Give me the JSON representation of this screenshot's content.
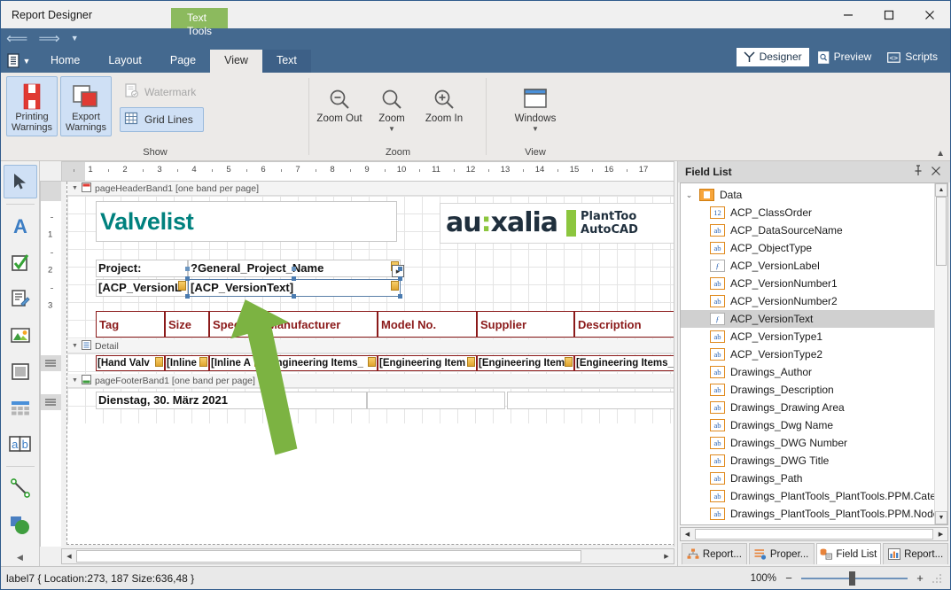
{
  "window": {
    "title": "Report Designer",
    "minimize": "—",
    "maximize": "□",
    "close": "✕"
  },
  "quick_access": {
    "undo_icon": "undo-icon",
    "redo_icon": "redo-icon",
    "customize_icon": "chevron-down-icon",
    "app_menu_icon": "application-menu-icon"
  },
  "ribbon": {
    "contextual_group": "Text Tools",
    "tabs": [
      {
        "label": "Home",
        "active": false
      },
      {
        "label": "Layout",
        "active": false
      },
      {
        "label": "Page",
        "active": false
      },
      {
        "label": "View",
        "active": true
      },
      {
        "label": "Text",
        "active": false,
        "contextual": true
      }
    ],
    "view_modes": [
      {
        "label": "Designer",
        "icon": "designer-icon",
        "active": true
      },
      {
        "label": "Preview",
        "icon": "preview-icon",
        "active": false
      },
      {
        "label": "Scripts",
        "icon": "scripts-icon",
        "active": false
      }
    ],
    "groups": [
      {
        "title": "Show",
        "big_buttons": [
          {
            "label_line1": "Printing",
            "label_line2": "Warnings",
            "icon": "printing-warnings-icon",
            "checked": true
          },
          {
            "label_line1": "Export",
            "label_line2": "Warnings",
            "icon": "export-warnings-icon",
            "checked": true
          }
        ],
        "small_buttons": [
          {
            "label": "Watermark",
            "icon": "watermark-icon",
            "disabled": true,
            "checked": false
          },
          {
            "label": "Grid Lines",
            "icon": "grid-lines-icon",
            "disabled": false,
            "checked": true
          }
        ]
      },
      {
        "title": "Zoom",
        "buttons": [
          {
            "label": "Zoom Out",
            "icon": "zoom-out-icon",
            "dropdown": false
          },
          {
            "label": "Zoom",
            "icon": "zoom-icon",
            "dropdown": true
          },
          {
            "label": "Zoom In",
            "icon": "zoom-in-icon",
            "dropdown": false
          }
        ]
      },
      {
        "title": "View",
        "buttons": [
          {
            "label": "Windows",
            "icon": "windows-icon",
            "dropdown": true
          }
        ]
      }
    ],
    "collapse_icon": "chevron-up-icon"
  },
  "toolbox": {
    "tools": [
      {
        "name": "pointer-tool",
        "icon": "pointer-icon",
        "selected": true
      },
      {
        "name": "label-tool",
        "icon": "label-A-icon",
        "selected": false
      },
      {
        "name": "check-box-tool",
        "icon": "check-box-icon",
        "selected": false
      },
      {
        "name": "rich-text-tool",
        "icon": "rich-text-icon",
        "selected": false
      },
      {
        "name": "picture-box-tool",
        "icon": "picture-box-icon",
        "selected": false
      },
      {
        "name": "panel-tool",
        "icon": "panel-icon",
        "selected": false
      },
      {
        "name": "table-tool",
        "icon": "table-icon",
        "selected": false
      },
      {
        "name": "character-comb-tool",
        "icon": "ab-box-icon",
        "selected": false
      },
      {
        "name": "line-tool",
        "icon": "line-icon",
        "selected": false
      },
      {
        "name": "shape-tool",
        "icon": "shape-icon",
        "selected": false
      }
    ],
    "collapse_icon": "collapse-left-icon"
  },
  "rulers": {
    "horizontal": [
      1,
      2,
      3,
      4,
      5,
      6,
      7,
      8,
      9,
      10,
      11,
      12,
      13,
      14,
      15,
      16,
      17
    ],
    "vertical": [
      1,
      2,
      3
    ]
  },
  "report": {
    "bands": [
      {
        "name": "pageHeaderBand1",
        "caption": "pageHeaderBand1 [one band per page]",
        "icon": "page-header-band-icon"
      },
      {
        "name": "Detail",
        "caption": "Detail",
        "icon": "detail-band-icon"
      },
      {
        "name": "pageFooterBand1",
        "caption": "pageFooterBand1 [one band per page]",
        "icon": "page-footer-band-icon"
      }
    ],
    "title": "Valvelist",
    "project_label": "Project:",
    "project_value": "?General_Project_Name",
    "version_label": "[ACP_VersionL",
    "version_value": "[ACP_VersionText]",
    "footer_date": "Dienstag, 30. März 2021",
    "logo": {
      "word_a": "au",
      "colon": ":",
      "word_b": "xalia",
      "product_line1": "PlantToo",
      "product_line2": "AutoCAD"
    },
    "table_headers": [
      "Tag",
      "Size",
      "Spec",
      "Manufacturer",
      "Model No.",
      "Supplier",
      "Description"
    ],
    "detail_cells": [
      "[Hand Valv",
      "[Inline ",
      "[Inline A",
      "[Engineering Items_",
      "[Engineering Item",
      "[Engineering Item",
      "[Engineering Items_D"
    ]
  },
  "field_list": {
    "title": "Field List",
    "pin_icon": "pin-icon",
    "close_icon": "close-icon",
    "root": {
      "label": "Data",
      "icon": "data-source-icon",
      "expanded": true
    },
    "fields": [
      {
        "label": "ACP_ClassOrder",
        "type": "12",
        "selected": false
      },
      {
        "label": "ACP_DataSourceName",
        "type": "ab",
        "selected": false
      },
      {
        "label": "ACP_ObjectType",
        "type": "ab",
        "selected": false
      },
      {
        "label": "ACP_VersionLabel",
        "type": "f",
        "selected": false
      },
      {
        "label": "ACP_VersionNumber1",
        "type": "ab",
        "selected": false
      },
      {
        "label": "ACP_VersionNumber2",
        "type": "ab",
        "selected": false
      },
      {
        "label": "ACP_VersionText",
        "type": "f",
        "selected": true
      },
      {
        "label": "ACP_VersionType1",
        "type": "ab",
        "selected": false
      },
      {
        "label": "ACP_VersionType2",
        "type": "ab",
        "selected": false
      },
      {
        "label": "Drawings_Author",
        "type": "ab",
        "selected": false
      },
      {
        "label": "Drawings_Description",
        "type": "ab",
        "selected": false
      },
      {
        "label": "Drawings_Drawing Area",
        "type": "ab",
        "selected": false
      },
      {
        "label": "Drawings_Dwg Name",
        "type": "ab",
        "selected": false
      },
      {
        "label": "Drawings_DWG Number",
        "type": "ab",
        "selected": false
      },
      {
        "label": "Drawings_DWG Title",
        "type": "ab",
        "selected": false
      },
      {
        "label": "Drawings_Path",
        "type": "ab",
        "selected": false
      },
      {
        "label": "Drawings_PlantTools_PlantTools.PPM.Category",
        "type": "ab",
        "selected": false
      },
      {
        "label": "Drawings_PlantTools_PlantTools.PPM.NodeDispl",
        "type": "ab",
        "selected": false
      }
    ],
    "tabs": [
      {
        "label": "Report...",
        "icon": "report-explorer-icon",
        "active": false
      },
      {
        "label": "Proper...",
        "icon": "property-grid-icon",
        "active": false
      },
      {
        "label": "Field List",
        "icon": "field-list-icon",
        "active": true
      },
      {
        "label": "Report...",
        "icon": "report-gallery-icon",
        "active": false
      }
    ]
  },
  "status_bar": {
    "selection_info": "label7 { Location:273, 187 Size:636,48 }",
    "zoom_percent": "100%",
    "zoom_out_sign": "−",
    "zoom_in_sign": "+"
  },
  "colors": {
    "ribbon_blue": "#44698f",
    "contextual_green": "#8cba5e",
    "title_teal": "#00817e",
    "header_darkred": "#8b1a1a",
    "accent_orange": "#e08a1e",
    "arrow_green": "#7cb342"
  }
}
